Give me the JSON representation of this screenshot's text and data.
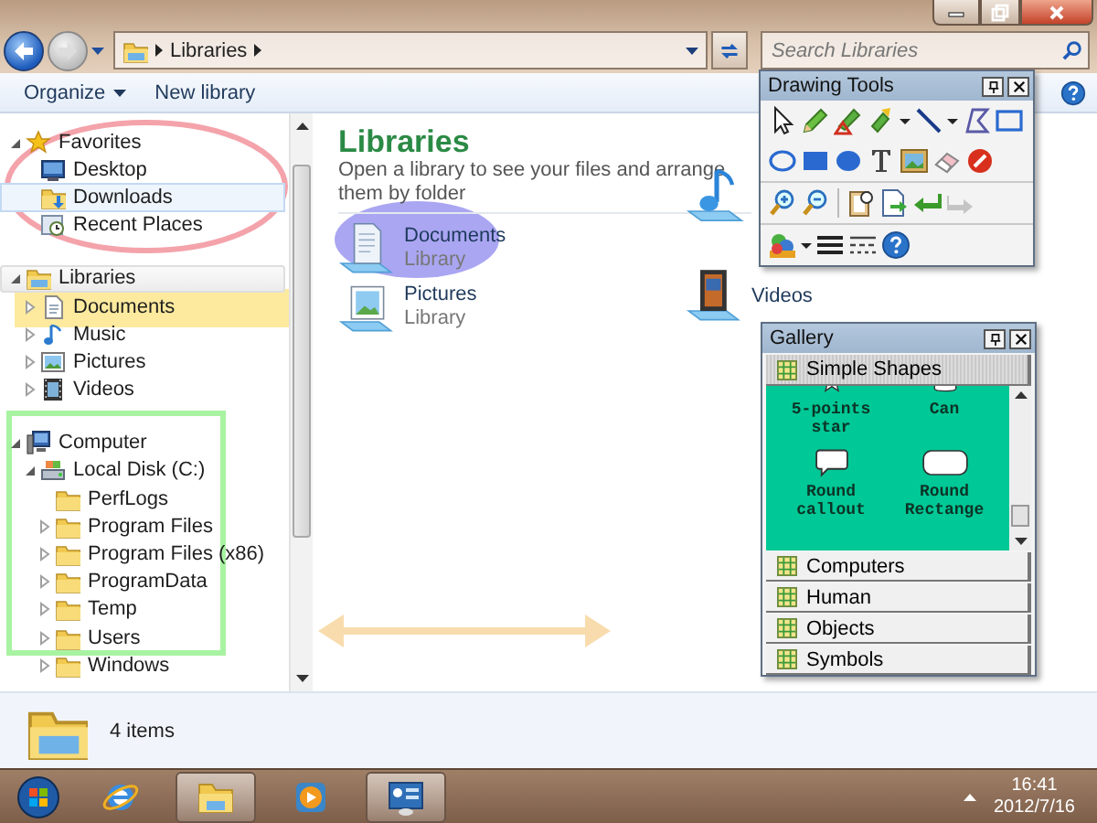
{
  "navigation": {
    "address": {
      "crumbs": [
        "Libraries"
      ]
    },
    "search": {
      "placeholder": "Search Libraries"
    }
  },
  "toolbar": {
    "buttons": [
      {
        "label": "Organize",
        "menu": true
      },
      {
        "label": "New library",
        "menu": false
      }
    ]
  },
  "nav_tree": [
    {
      "label": "Favorites",
      "kind": "favorites",
      "expanded": true,
      "selected": false,
      "hovered": false,
      "children": [
        {
          "label": "Desktop",
          "kind": "desktop",
          "selected": false,
          "hovered": false
        },
        {
          "label": "Downloads",
          "kind": "downloads",
          "selected": true,
          "hovered": false
        },
        {
          "label": "Recent Places",
          "kind": "recent",
          "selected": false,
          "hovered": false
        }
      ]
    },
    {
      "label": "Libraries",
      "kind": "libraries",
      "expanded": true,
      "selected": false,
      "hovered": true,
      "children": [
        {
          "label": "Documents",
          "kind": "documents",
          "expanded": false,
          "selected": false,
          "hovered": false
        },
        {
          "label": "Music",
          "kind": "music",
          "expanded": false,
          "selected": false,
          "hovered": false
        },
        {
          "label": "Pictures",
          "kind": "pictures",
          "expanded": false,
          "selected": false,
          "hovered": false
        },
        {
          "label": "Videos",
          "kind": "videos",
          "expanded": false,
          "selected": false,
          "hovered": false
        }
      ]
    },
    {
      "label": "Computer",
      "kind": "computer",
      "expanded": true,
      "selected": false,
      "hovered": false,
      "children": [
        {
          "label": "Local Disk (C:)",
          "kind": "drive",
          "expanded": true,
          "selected": false,
          "hovered": false,
          "children": [
            {
              "label": "PerfLogs",
              "kind": "folder",
              "selected": false,
              "hovered": false
            },
            {
              "label": "Program Files",
              "kind": "folder",
              "expanded": false,
              "selected": false,
              "hovered": false
            },
            {
              "label": "Program Files (x86)",
              "kind": "folder",
              "expanded": false,
              "selected": false,
              "hovered": false
            },
            {
              "label": "ProgramData",
              "kind": "folder",
              "expanded": false,
              "selected": false,
              "hovered": false
            },
            {
              "label": "Temp",
              "kind": "folder",
              "expanded": false,
              "selected": false,
              "hovered": false
            },
            {
              "label": "Users",
              "kind": "folder",
              "expanded": false,
              "selected": false,
              "hovered": false
            },
            {
              "label": "Windows",
              "kind": "folder",
              "expanded": false,
              "selected": false,
              "hovered": false
            }
          ]
        }
      ]
    }
  ],
  "content": {
    "title": "Libraries",
    "subtitle": "Open a library to see your files and arrange them by folder",
    "libraries": [
      {
        "kind": "documents",
        "name": "Documents",
        "subtitle": "Library"
      },
      {
        "kind": "music"
      },
      {
        "kind": "pictures",
        "name": "Pictures",
        "subtitle": "Library"
      },
      {
        "kind": "videos",
        "name": "Videos"
      }
    ]
  },
  "status_bar": {
    "text": "4 items"
  },
  "drawing_tools": {
    "title": "Drawing Tools",
    "redo": {
      "disabled": true
    }
  },
  "gallery": {
    "title": "Gallery",
    "sections": [
      {
        "label": "Simple Shapes",
        "expanded": true,
        "shapes": [
          {
            "kind": "star",
            "label": "5-points star"
          },
          {
            "kind": "can",
            "label": "Can"
          },
          {
            "kind": "callout",
            "label": "Round callout"
          },
          {
            "kind": "round-rect",
            "label": "Round Rectange"
          }
        ]
      },
      {
        "label": "Computers",
        "expanded": false
      },
      {
        "label": "Human",
        "expanded": false
      },
      {
        "label": "Objects",
        "expanded": false
      },
      {
        "label": "Symbols",
        "expanded": false
      }
    ]
  },
  "taskbar": {
    "apps": [
      {
        "kind": "browser",
        "open": false
      },
      {
        "kind": "explorer",
        "open": true
      },
      {
        "kind": "media",
        "open": false
      },
      {
        "kind": "drawing",
        "open": true
      }
    ],
    "clock": {
      "time": "16:41",
      "date": "2012/7/16"
    }
  }
}
